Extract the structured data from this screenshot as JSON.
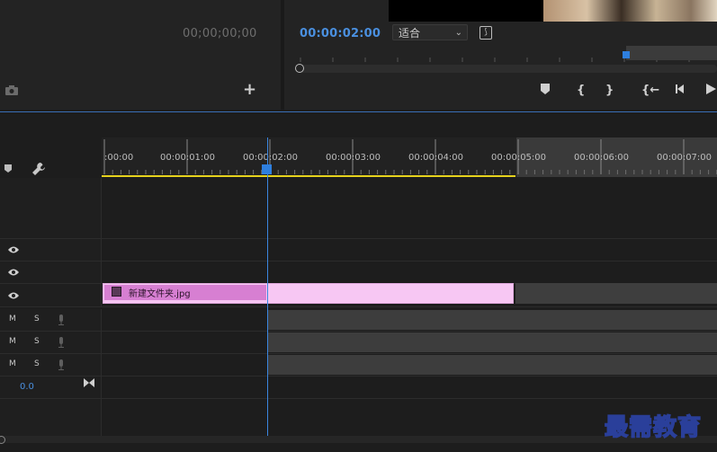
{
  "source_monitor": {
    "timecode": "00;00;00;00"
  },
  "program_monitor": {
    "timecode": "00:00:02:00",
    "fit": {
      "selected": "适合"
    }
  },
  "timeline": {
    "ruler_labels": [
      ":00:00",
      "00:00:01:00",
      "00:00:02:00",
      "00:00:03:00",
      "00:00:04:00",
      "00:00:05:00",
      "00:00:06:00",
      "00:00:07:00"
    ],
    "playhead_time": "00:00:02:00",
    "clip": {
      "name": "新建文件夹.jpg"
    },
    "audio_tracks": [
      {
        "mute": "M",
        "solo": "S"
      },
      {
        "mute": "M",
        "solo": "S"
      },
      {
        "mute": "M",
        "solo": "S"
      }
    ],
    "master_volume": "0.0"
  },
  "watermark": "最需教育",
  "colors": {
    "accent": "#2e7fde",
    "timecode_blue": "#4a90e0",
    "work_area": "#e6d21c",
    "clip": "#f7c7f3",
    "clip_label": "#d77fd2"
  }
}
